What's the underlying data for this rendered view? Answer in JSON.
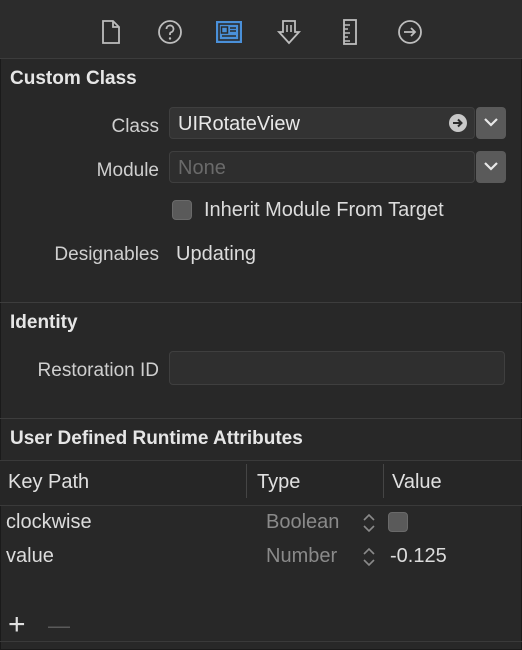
{
  "toolbar": {
    "icons": [
      "file-icon",
      "help-icon",
      "identity-inspector-icon",
      "attributes-icon",
      "size-ruler-icon",
      "connections-arrow-icon"
    ]
  },
  "custom_class": {
    "title": "Custom Class",
    "class_label": "Class",
    "class_value": "UIRotateView",
    "module_label": "Module",
    "module_placeholder": "None",
    "inherit_label": "Inherit Module From Target",
    "designables_label": "Designables",
    "designables_value": "Updating"
  },
  "identity": {
    "title": "Identity",
    "restoration_label": "Restoration ID",
    "restoration_value": ""
  },
  "runtime_attributes": {
    "title": "User Defined Runtime Attributes",
    "columns": [
      "Key Path",
      "Type",
      "Value"
    ],
    "rows": [
      {
        "key": "clockwise",
        "type": "Boolean",
        "value": ""
      },
      {
        "key": "value",
        "type": "Number",
        "value": "-0.125"
      }
    ],
    "add_symbol": "+",
    "remove_symbol": "—"
  },
  "colors": {
    "background": "#282828",
    "accent": "#4a90d9"
  }
}
